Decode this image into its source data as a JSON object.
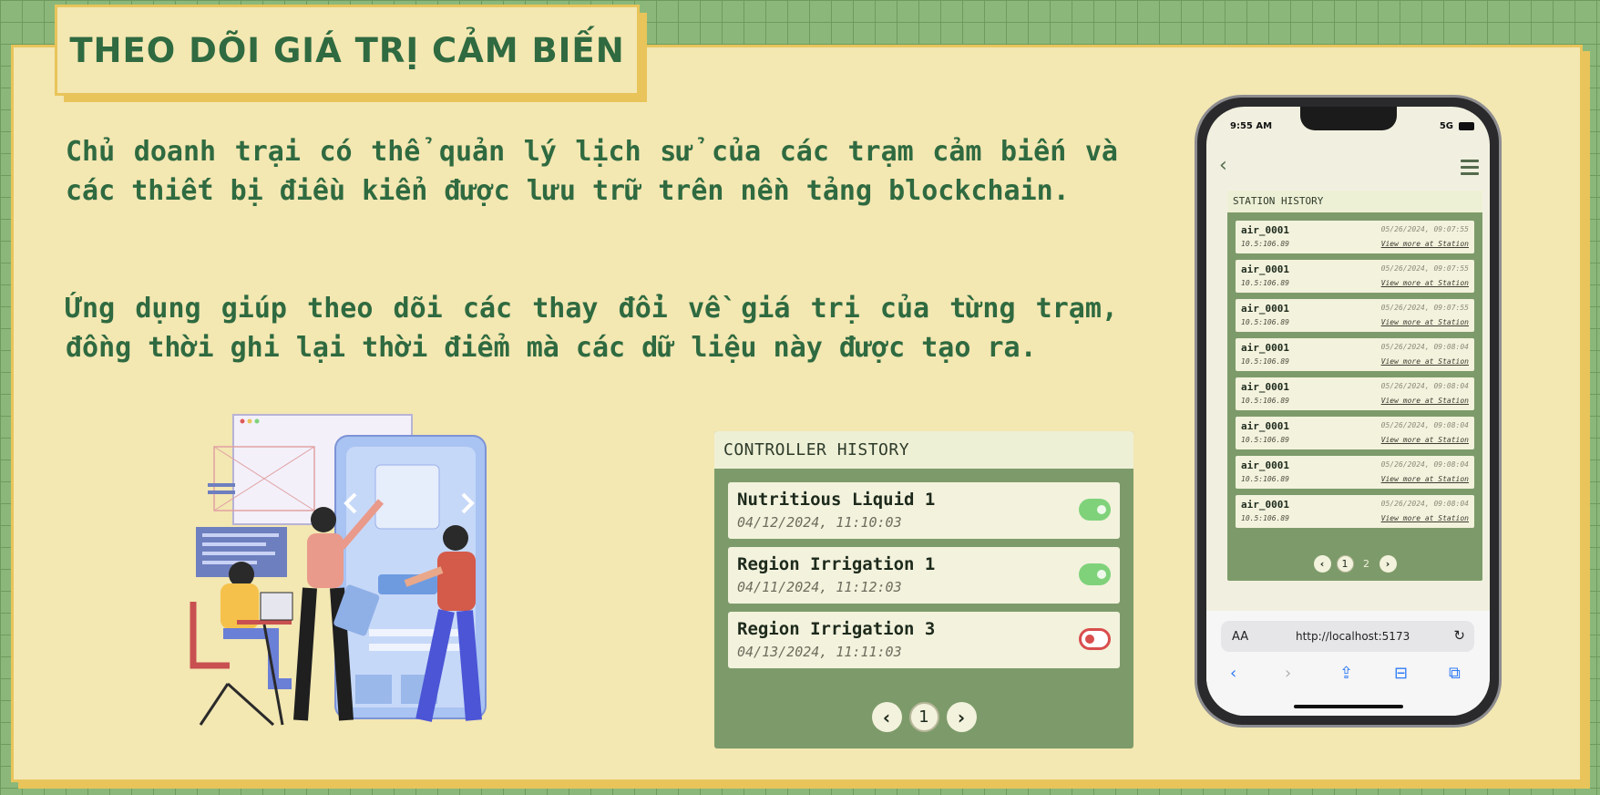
{
  "title": "THEO DÕI GIÁ TRỊ CẢM BIẾN",
  "paragraphs": [
    "Chủ doanh trại có thể quản lý lịch sử của các trạm cảm biến và các thiết bị điều kiển được lưu trữ trên nền tảng blockchain.",
    "Ứng dụng giúp theo dõi các thay đổi về giá trị của từng trạm, đồng thời ghi lại thời điểm mà các dữ liệu này được tạo ra."
  ],
  "controller_history": {
    "heading": "CONTROLLER HISTORY",
    "items": [
      {
        "name": "Nutritious Liquid 1",
        "date": "04/12/2024, 11:10:03",
        "state": "on"
      },
      {
        "name": "Region Irrigation 1",
        "date": "04/11/2024, 11:12:03",
        "state": "on"
      },
      {
        "name": "Region Irrigation 3",
        "date": "04/13/2024, 11:11:03",
        "state": "off"
      }
    ],
    "pager": {
      "prev": "‹",
      "page": "1",
      "next": "›"
    }
  },
  "phone": {
    "status": {
      "time": "9:55 AM",
      "network": "5G"
    },
    "station_history": {
      "heading": "STATION HISTORY",
      "items": [
        {
          "name": "air_0001",
          "coords": "10.5:106.89",
          "time": "05/26/2024, 09:07:55",
          "link": "View more at Station"
        },
        {
          "name": "air_0001",
          "coords": "10.5:106.89",
          "time": "05/26/2024, 09:07:55",
          "link": "View more at Station"
        },
        {
          "name": "air_0001",
          "coords": "10.5:106.89",
          "time": "05/26/2024, 09:07:55",
          "link": "View more at Station"
        },
        {
          "name": "air_0001",
          "coords": "10.5:106.89",
          "time": "05/26/2024, 09:08:04",
          "link": "View more at Station"
        },
        {
          "name": "air_0001",
          "coords": "10.5:106.89",
          "time": "05/26/2024, 09:08:04",
          "link": "View more at Station"
        },
        {
          "name": "air_0001",
          "coords": "10.5:106.89",
          "time": "05/26/2024, 09:08:04",
          "link": "View more at Station"
        },
        {
          "name": "air_0001",
          "coords": "10.5:106.89",
          "time": "05/26/2024, 09:08:04",
          "link": "View more at Station"
        },
        {
          "name": "air_0001",
          "coords": "10.5:106.89",
          "time": "05/26/2024, 09:08:04",
          "link": "View more at Station"
        }
      ],
      "pager": {
        "prev": "‹",
        "page1": "1",
        "page2": "2",
        "next": "›"
      }
    },
    "browser": {
      "aa": "AA",
      "url": "http://localhost:5173"
    }
  },
  "colors": {
    "accent_green": "#2f6a40",
    "panel_green": "#7d9b6a",
    "toggle_on": "#7fd27a",
    "toggle_off": "#d94d4d",
    "card_bg": "#f3e7b2",
    "border_yellow": "#e8c45a"
  }
}
